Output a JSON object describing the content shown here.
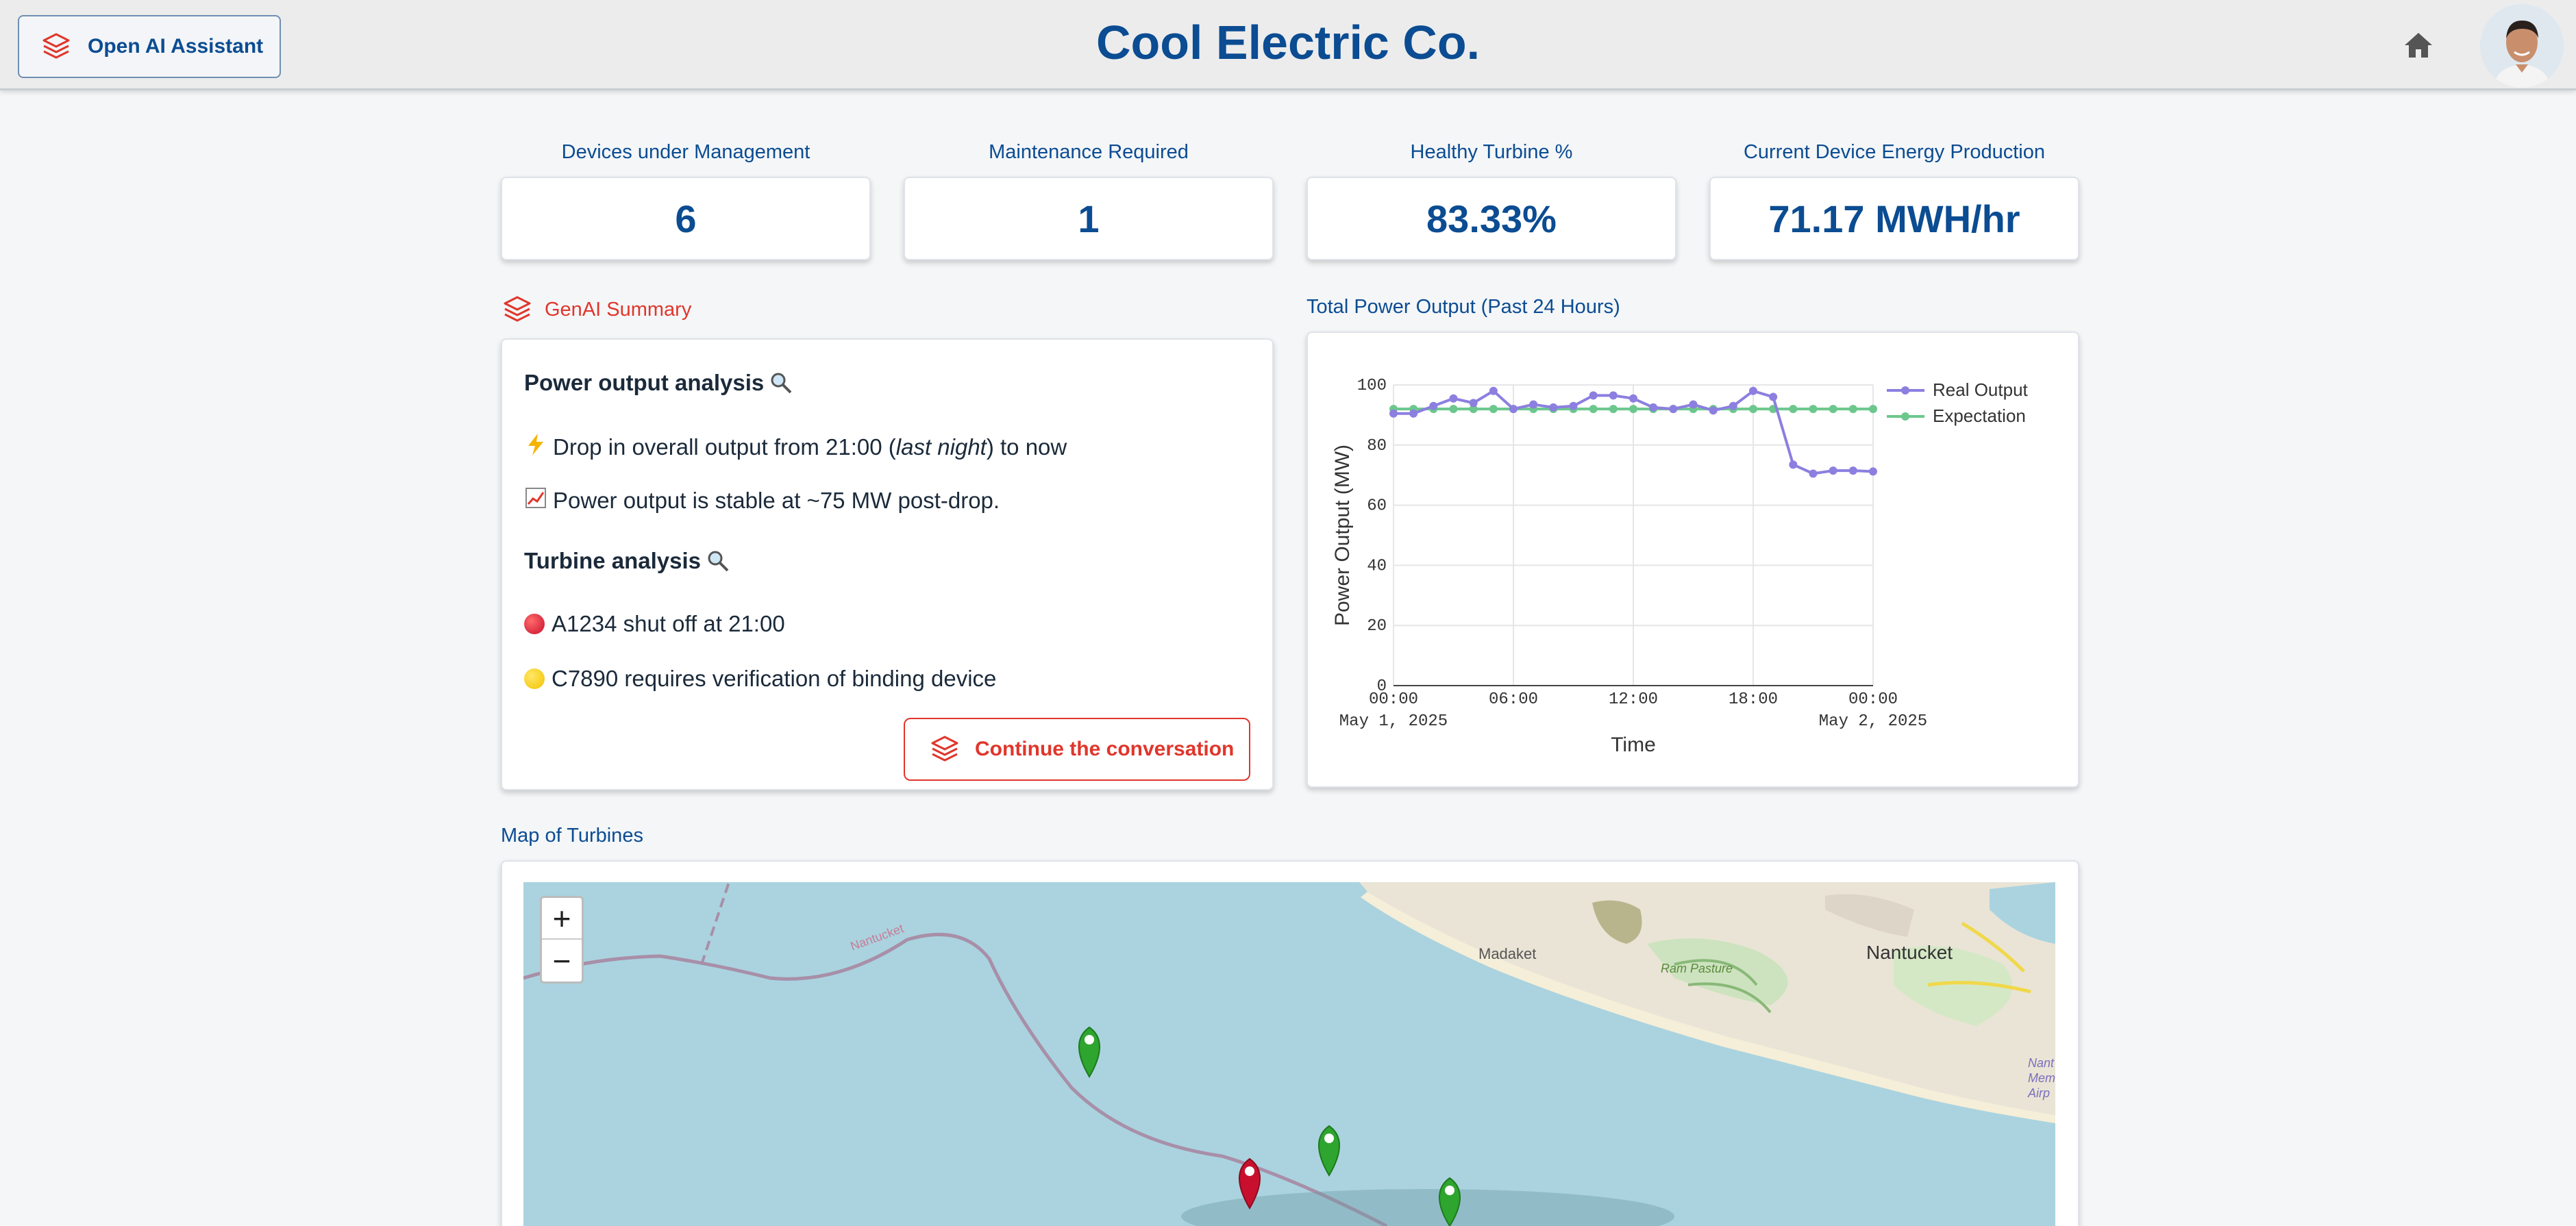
{
  "header": {
    "assistant_button": "Open AI Assistant",
    "brand": "Cool Electric Co."
  },
  "kpis": [
    {
      "label": "Devices under Management",
      "value": "6"
    },
    {
      "label": "Maintenance Required",
      "value": "1"
    },
    {
      "label": "Healthy Turbine %",
      "value": "83.33%"
    },
    {
      "label": "Current Device Energy Production",
      "value": "71.17 MWH/hr"
    }
  ],
  "summary": {
    "title": "GenAI Summary",
    "power_heading": "Power output analysis",
    "drop_pre": "Drop in overall output from 21:00 (",
    "drop_em": "last night",
    "drop_post": ") to now",
    "stable": "Power output is stable at ~75 MW post-drop.",
    "turbine_heading": "Turbine analysis",
    "a1234": "A1234 shut off at 21:00",
    "c7890": "C7890 requires verification of binding device",
    "continue_button": "Continue the conversation"
  },
  "chart_title": "Total Power Output (Past 24 Hours)",
  "chart_data": {
    "type": "line",
    "x": [
      "00:00",
      "01:00",
      "02:00",
      "03:00",
      "04:00",
      "05:00",
      "06:00",
      "07:00",
      "08:00",
      "09:00",
      "10:00",
      "11:00",
      "12:00",
      "13:00",
      "14:00",
      "15:00",
      "16:00",
      "17:00",
      "18:00",
      "19:00",
      "20:00",
      "21:00",
      "22:00",
      "23:00",
      "00:00"
    ],
    "series": [
      {
        "name": "Real Output",
        "color": "#8c7fe0",
        "values": [
          90.5,
          90.5,
          93,
          95.5,
          94,
          98,
          92,
          93.5,
          92.5,
          93,
          96.5,
          96.5,
          95.5,
          92.5,
          92,
          93.5,
          91.5,
          93,
          98,
          96,
          73.5,
          70.5,
          71.5,
          71.5,
          71.2
        ]
      },
      {
        "name": "Expectation",
        "color": "#6cc78d",
        "values": [
          92,
          92,
          92,
          92,
          92,
          92,
          92,
          92,
          92,
          92,
          92,
          92,
          92,
          92,
          92,
          92,
          92,
          92,
          92,
          92,
          92,
          92,
          92,
          92,
          92
        ]
      }
    ],
    "xticks": [
      {
        "idx": 0,
        "time": "00:00",
        "date": "May 1, 2025"
      },
      {
        "idx": 6,
        "time": "06:00",
        "date": ""
      },
      {
        "idx": 12,
        "time": "12:00",
        "date": ""
      },
      {
        "idx": 18,
        "time": "18:00",
        "date": ""
      },
      {
        "idx": 24,
        "time": "00:00",
        "date": "May 2, 2025"
      }
    ],
    "yticks": [
      0,
      20,
      40,
      60,
      80,
      100
    ],
    "ylim": [
      0,
      100
    ],
    "xlabel": "Time",
    "ylabel": "Power Output (MW)",
    "legend": "top-right",
    "grid": true
  },
  "map": {
    "title": "Map of Turbines",
    "labels": {
      "madaket": "Madaket",
      "nantucket": "Nantucket",
      "boundary": "Nantucket",
      "ram": "Ram Pasture",
      "nant": "Nant",
      "mem": "Mem",
      "air": "Airp"
    },
    "zoom_in": "+",
    "zoom_out": "−"
  }
}
